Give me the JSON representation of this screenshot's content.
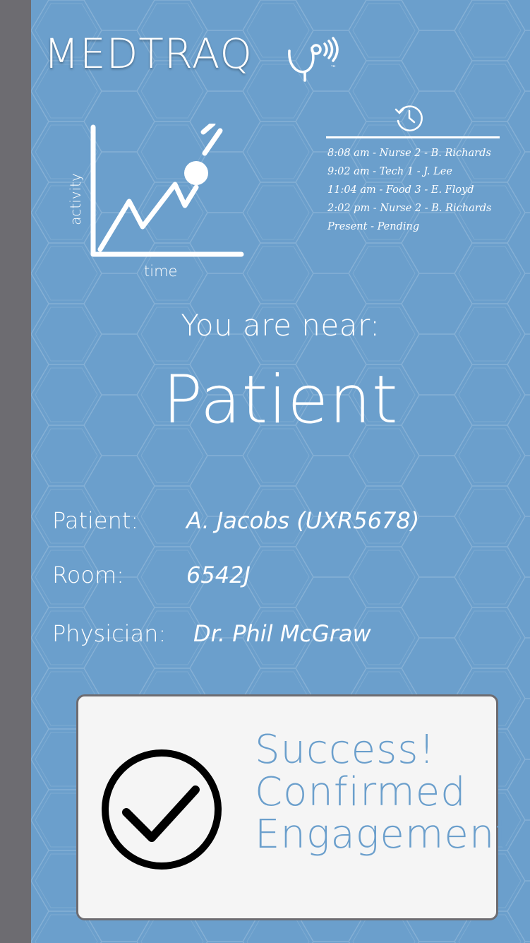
{
  "brand": {
    "name": "MEDTRAQ",
    "trademark": "™"
  },
  "graph": {
    "x_label": "time",
    "y_label": "activity"
  },
  "history": {
    "icon": "history-clock-icon",
    "entries": [
      "8:08 am - Nurse 2 - B. Richards",
      "9:02 am - Tech 1 - J. Lee",
      "11:04 am - Food 3 - E. Floyd",
      "2:02 pm  - Nurse 2 - B. Richards",
      "Present    - Pending"
    ]
  },
  "proximity": {
    "label": "You are near:",
    "entity": "Patient"
  },
  "details": {
    "patient_label": "Patient:",
    "patient_value": "A. Jacobs (UXR5678)",
    "room_label": "Room:",
    "room_value": "6542J",
    "physician_label": "Physician:",
    "physician_value": "Dr. Phil McGraw"
  },
  "status": {
    "icon": "checkmark-circle-icon",
    "line1": "Success!",
    "line2": "Confirmed",
    "line3": "Engagement"
  },
  "colors": {
    "background": "#6b9fcc",
    "sidebar": "#6d6c71",
    "card": "#f5f5f5",
    "accent_text": "#6b9fcc"
  }
}
